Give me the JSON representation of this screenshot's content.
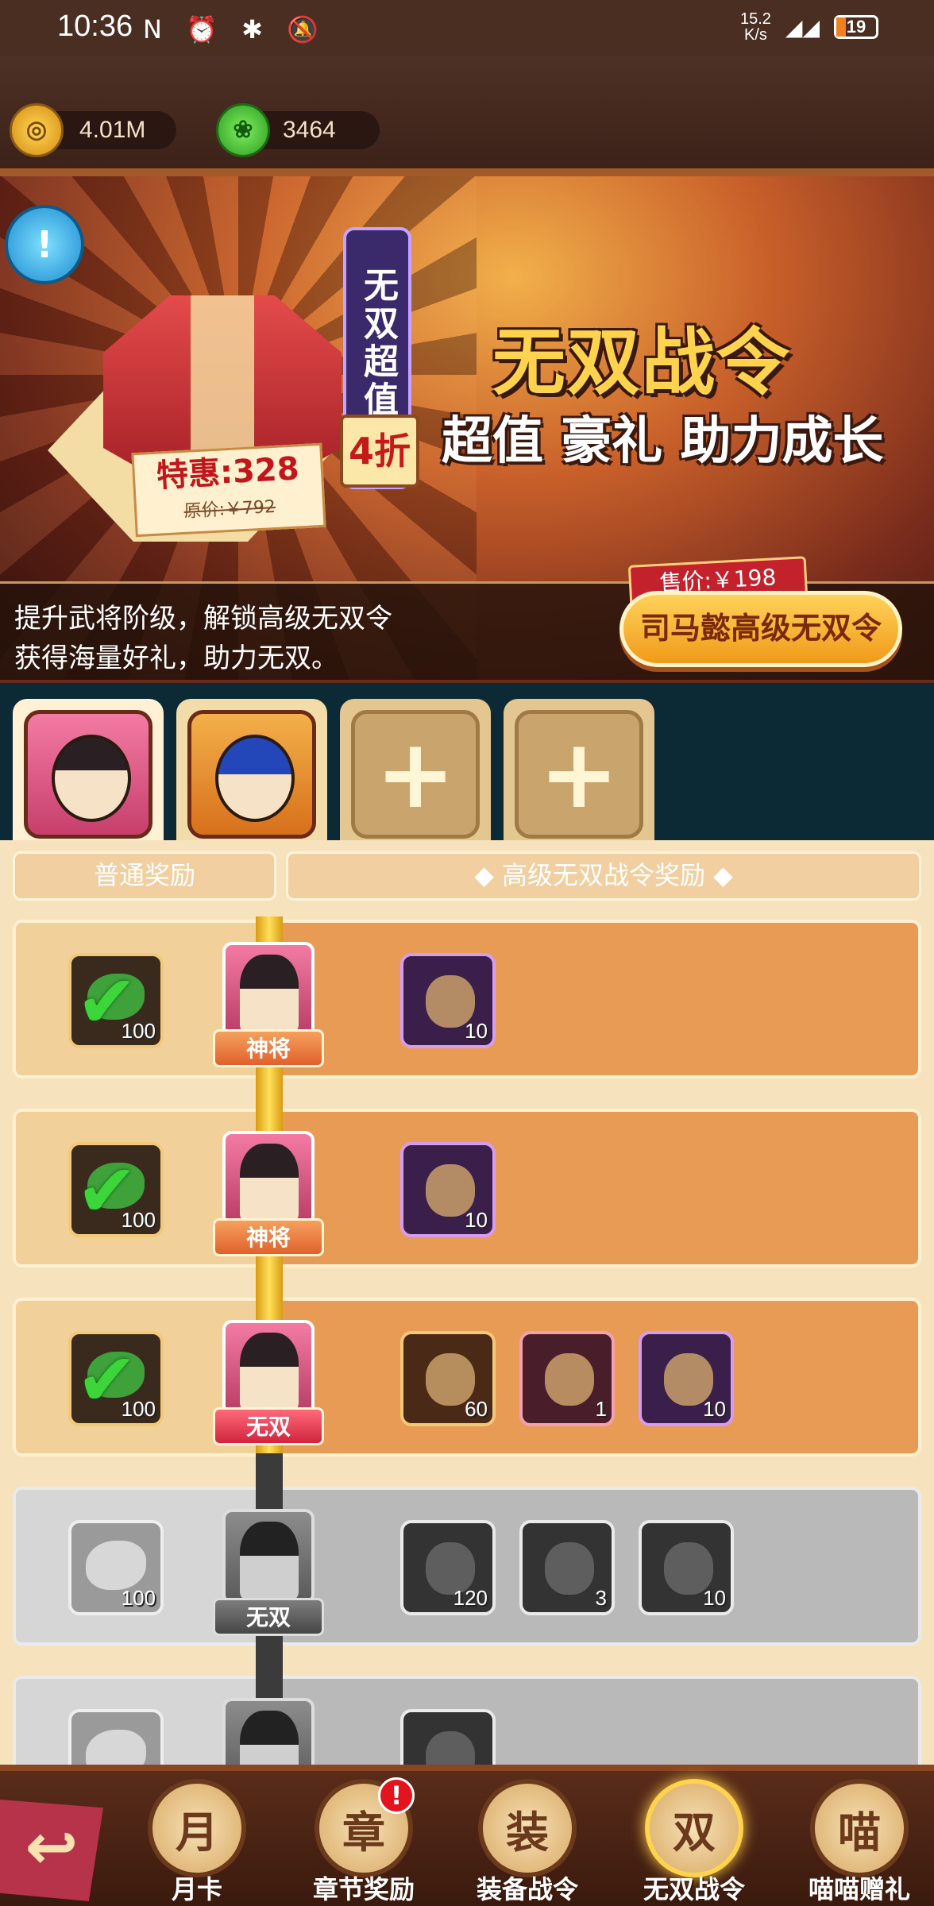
{
  "status_bar": {
    "time": "10:36",
    "icons": "N ⏰ ✱ 🔕",
    "speed": "15.2\nK/s",
    "signal": "4G",
    "battery": "19"
  },
  "resources": {
    "coins": "4.01M",
    "jade": "3464"
  },
  "banner": {
    "vertical_title": "无双超值礼",
    "discount": "4折",
    "special_price": "特惠:328",
    "original_price": "原价:￥792",
    "title": "无双战令",
    "subtitle_big": "超值",
    "subtitle_rest": "豪礼 助力成长",
    "desc_line1": "提升武将阶级，解锁高级无双令",
    "desc_line2": "获得海量好礼，助力无双。",
    "sale_price": "售价:￥198",
    "buy_button": "司马懿高级无双令"
  },
  "hero_tabs": {
    "add1": "+",
    "add2": "+"
  },
  "reward_headers": {
    "normal": "普通奖励",
    "premium": "◆ 高级无双战令奖励 ◆"
  },
  "rows": [
    {
      "state": "claimed",
      "normal_count": "100",
      "node_badge": "神将",
      "premium": [
        {
          "count": "10"
        }
      ]
    },
    {
      "state": "claimed",
      "normal_count": "100",
      "node_badge": "神将",
      "premium": [
        {
          "count": "10"
        }
      ]
    },
    {
      "state": "claimed",
      "normal_count": "100",
      "node_badge": "无双",
      "premium": [
        {
          "count": "60"
        },
        {
          "count": "1"
        },
        {
          "count": "10"
        }
      ]
    },
    {
      "state": "locked",
      "normal_count": "100",
      "node_badge": "无双",
      "premium": [
        {
          "count": "120"
        },
        {
          "count": "3"
        },
        {
          "count": "10"
        }
      ]
    },
    {
      "state": "locked",
      "normal_count": "",
      "node_badge": "",
      "premium": [
        {
          "count": ""
        }
      ]
    }
  ],
  "bottom_nav": {
    "items": [
      {
        "label": "月卡",
        "icon": "月"
      },
      {
        "label": "章节奖励",
        "icon": "章",
        "badge": "!"
      },
      {
        "label": "装备战令",
        "icon": "装"
      },
      {
        "label": "无双战令",
        "icon": "双"
      },
      {
        "label": "喵喵赠礼",
        "icon": "喵"
      }
    ],
    "back_icon": "↩"
  }
}
